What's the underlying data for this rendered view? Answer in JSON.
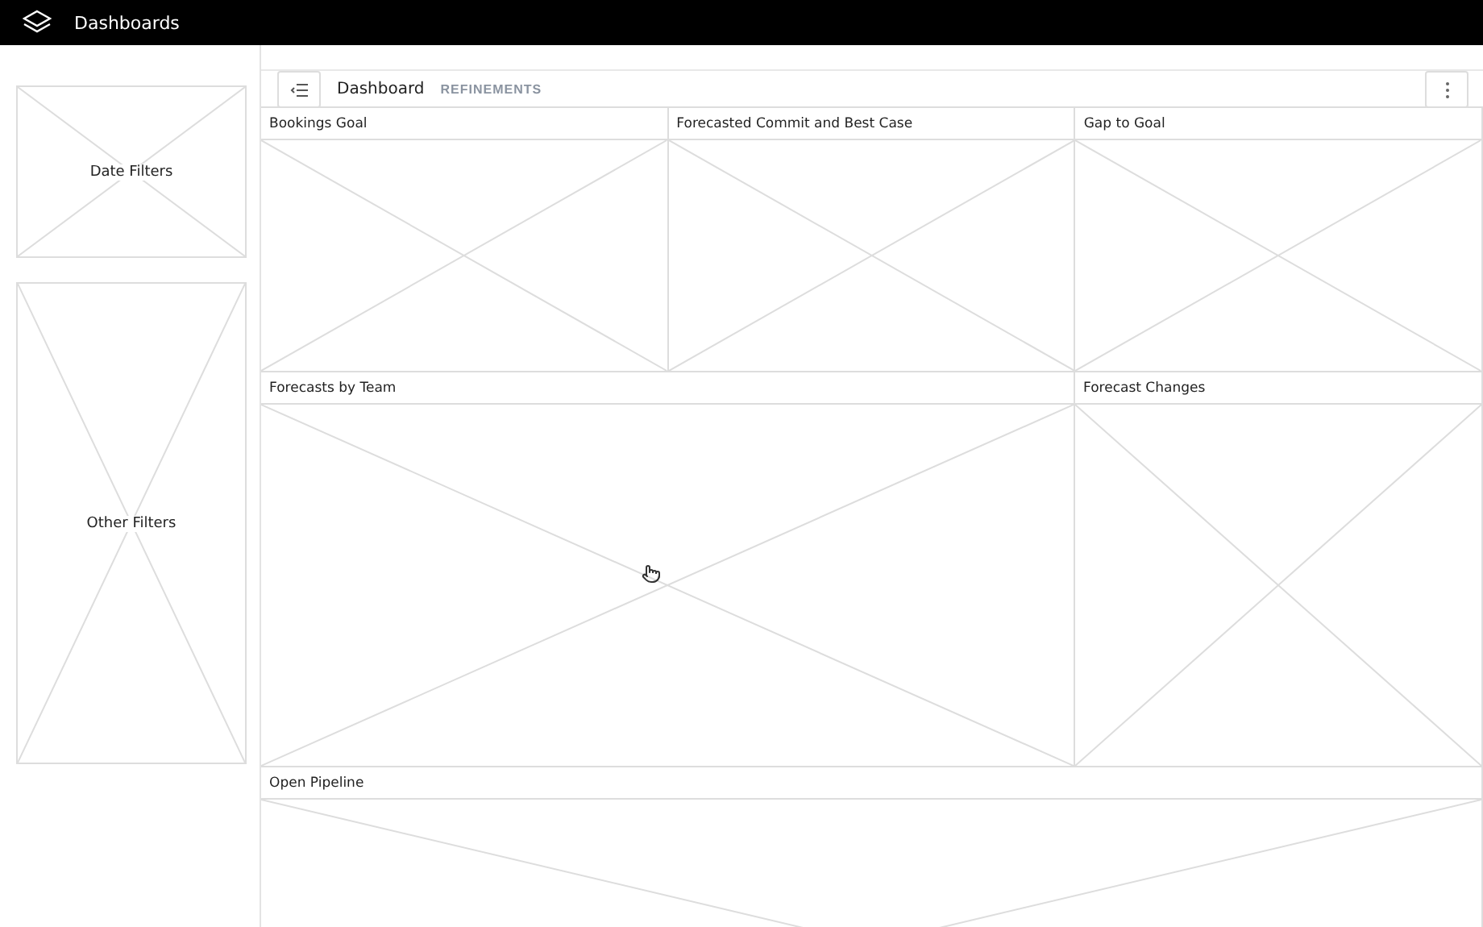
{
  "top_bar": {
    "title": "Dashboards"
  },
  "sidebar": {
    "filters": [
      {
        "label": "Date Filters",
        "tall": false
      },
      {
        "label": "Other Filters",
        "tall": true
      }
    ]
  },
  "toolbar": {
    "title": "Dashboard",
    "tab": "REFINEMENTS"
  },
  "rows": [
    {
      "panels": [
        {
          "title": "Bookings Goal"
        },
        {
          "title": "Forecasted Commit and Best Case"
        },
        {
          "title": "Gap to Goal"
        }
      ]
    },
    {
      "panels": [
        {
          "title": "Forecasts by Team"
        },
        {
          "title": "Forecast Changes"
        }
      ]
    },
    {
      "panels": [
        {
          "title": "Open Pipeline"
        }
      ]
    }
  ]
}
